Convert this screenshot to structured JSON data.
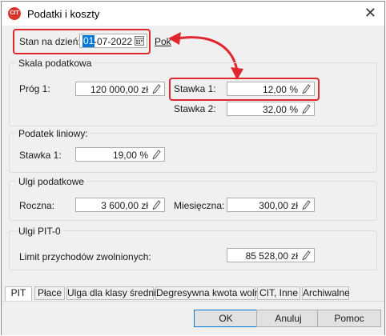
{
  "window": {
    "title": "Podatki i koszty",
    "app_icon": "CIT",
    "close_icon": "✕"
  },
  "header": {
    "date_label": "Stan na dzień:",
    "date_selected": "01",
    "date_rest": "-07-2022",
    "link_label": "Pok"
  },
  "skala": {
    "title": "Skala podatkowa",
    "prog1_label": "Próg 1:",
    "prog1_value": "120 000,00 zł",
    "stawka1_label": "Stawka 1:",
    "stawka1_value": "12,00 %",
    "stawka2_label": "Stawka 2:",
    "stawka2_value": "32,00 %"
  },
  "liniowy": {
    "title": "Podatek liniowy:",
    "stawka1_label": "Stawka 1:",
    "stawka1_value": "19,00 %"
  },
  "ulgi": {
    "title": "Ulgi podatkowe",
    "roczna_label": "Roczna:",
    "roczna_value": "3 600,00 zł",
    "miesieczna_label": "Miesięczna:",
    "miesieczna_value": "300,00 zł"
  },
  "pit0": {
    "title": "Ulgi PIT-0",
    "limit_label": "Limit przychodów zwolnionych:",
    "limit_value": "85 528,00 zł"
  },
  "tabs": [
    "PIT",
    "Płace",
    "Ulga dla klasy średniej",
    "Degresywna kwota wolna",
    "CIT, Inne",
    "Archiwalne"
  ],
  "buttons": {
    "ok": "OK",
    "cancel": "Anuluj",
    "help": "Pomoc"
  },
  "colors": {
    "highlight": "#e0262e",
    "selection": "#0078d7"
  }
}
